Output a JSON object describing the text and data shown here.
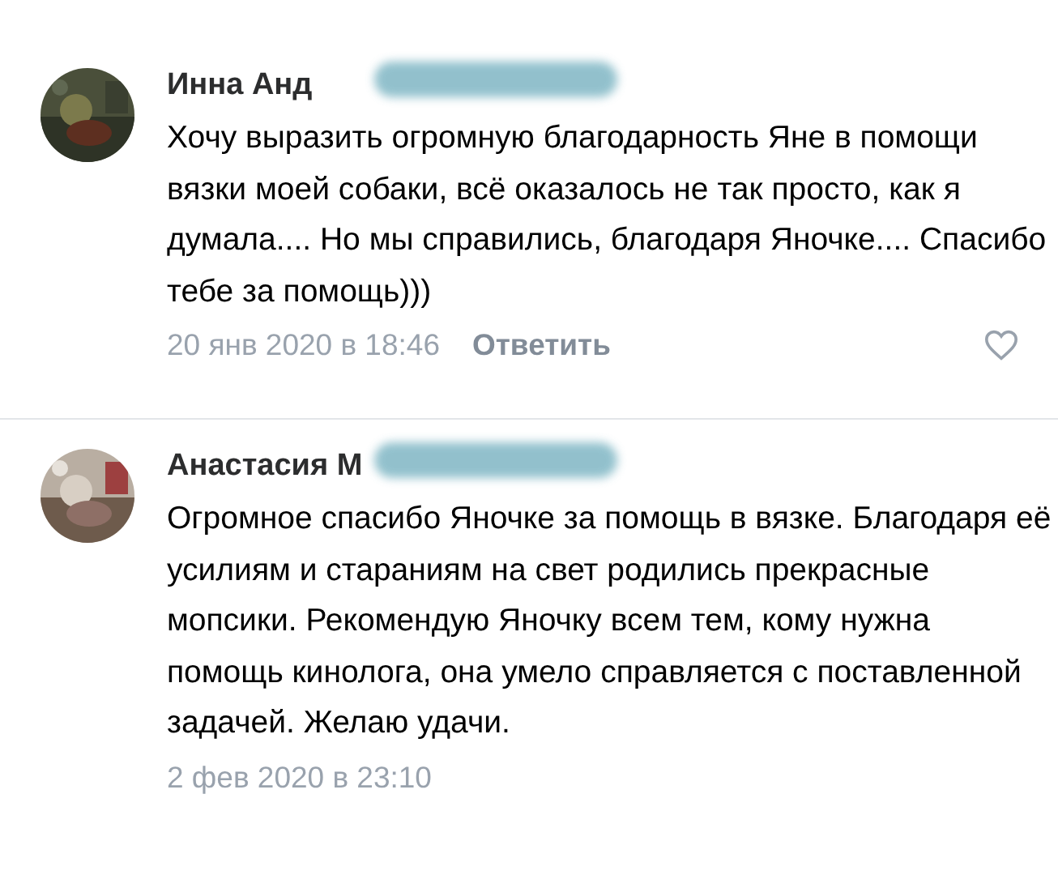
{
  "comments": [
    {
      "author": "Инна Анд",
      "redacted": true,
      "text": "Хочу выразить огромную благодарность Яне в помощи вязки моей собаки, всё оказалось не так просто, как я думала.... Но мы справились, благодаря Яночке.... Спасибо тебе за помощь)))",
      "date": "20 янв 2020 в 18:46",
      "reply": "Ответить",
      "liked": false
    },
    {
      "author": "Анастасия М",
      "redacted": true,
      "text": "Огромное спасибо Яночке за помощь в вязке. Благодаря её усилиям и стараниям на свет родились прекрасные мопсики. Рекомендую Яночку всем тем, кому нужна помощь кинолога, она умело справляется с поставленной задачей. Желаю удачи.",
      "date": "2 фев 2020 в 23:10"
    }
  ]
}
